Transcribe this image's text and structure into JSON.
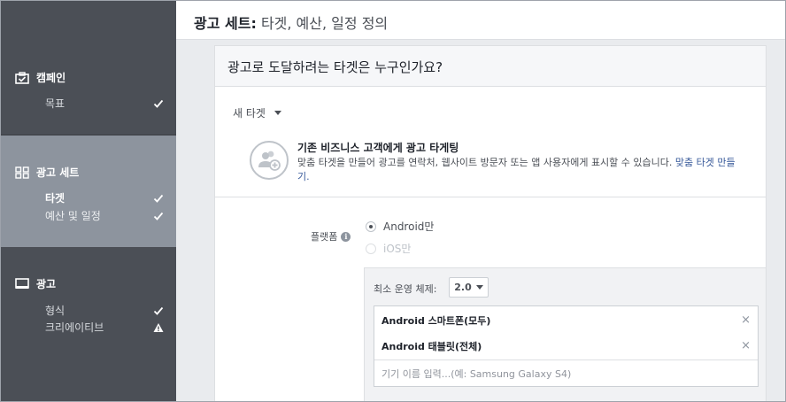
{
  "header": {
    "title_strong": "광고 세트:",
    "title_rest": " 타겟, 예산, 일정 정의"
  },
  "sidebar": {
    "sections": [
      {
        "label": "캠페인",
        "icon": "briefcase-check-icon",
        "items": [
          {
            "label": "목표",
            "status": "check"
          }
        ]
      },
      {
        "label": "광고 세트",
        "icon": "grid-icon",
        "items": [
          {
            "label": "타겟",
            "status": "check"
          },
          {
            "label": "예산 및 일정",
            "status": "check"
          }
        ]
      },
      {
        "label": "광고",
        "icon": "monitor-icon",
        "items": [
          {
            "label": "형식",
            "status": "check"
          },
          {
            "label": "크리에이티브",
            "status": "warning"
          }
        ]
      }
    ]
  },
  "card": {
    "heading": "광고로 도달하려는 타겟은 누구인가요?",
    "new_target_label": "새 타겟",
    "promo": {
      "title": "기존 비즈니스 고객에게 광고 타게팅",
      "desc": "맞춤 타겟을 만들어 광고를 연락처, 웹사이트 방문자 또는 앱 사용자에게 표시할 수 있습니다. ",
      "link": "맞춤 타겟 만들기."
    },
    "platform": {
      "label": "플랫폼",
      "options": [
        {
          "label": "Android만",
          "selected": true,
          "enabled": true
        },
        {
          "label": "iOS만",
          "selected": false,
          "enabled": false
        }
      ]
    },
    "os": {
      "label": "최소 운영 체제:",
      "version": "2.0",
      "devices": [
        "Android 스마트폰(모두)",
        "Android 태블릿(전체)"
      ],
      "device_remove": "×",
      "device_placeholder": "기기 이름 입력...(예: Samsung Galaxy S4)"
    }
  },
  "colors": {
    "sidebar_bg": "#4b4f56",
    "sidebar_active_bg": "#8d949e",
    "link": "#365899"
  }
}
